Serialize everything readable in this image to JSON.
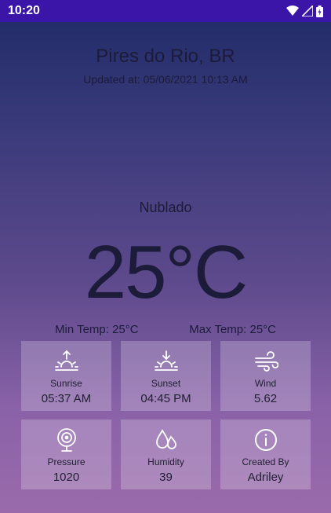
{
  "status_bar": {
    "time": "10:20"
  },
  "header": {
    "location": "Pires do Rio, BR",
    "updated": "Updated at: 05/06/2021 10:13 AM"
  },
  "weather": {
    "status": "Nublado",
    "temperature": "25°C",
    "min_temp": "Min Temp: 25°C",
    "max_temp": "Max Temp: 25°C"
  },
  "cards": [
    {
      "label": "Sunrise",
      "value": "05:37 AM",
      "icon": "sunrise-icon"
    },
    {
      "label": "Sunset",
      "value": "04:45 PM",
      "icon": "sunset-icon"
    },
    {
      "label": "Wind",
      "value": "5.62",
      "icon": "wind-icon"
    },
    {
      "label": "Pressure",
      "value": "1020",
      "icon": "pressure-icon"
    },
    {
      "label": "Humidity",
      "value": "39",
      "icon": "humidity-icon"
    },
    {
      "label": "Created By",
      "value": "Adriley",
      "icon": "info-icon"
    }
  ],
  "colors": {
    "status_bar": "#3b14a8",
    "text": "#1c1b3a"
  }
}
